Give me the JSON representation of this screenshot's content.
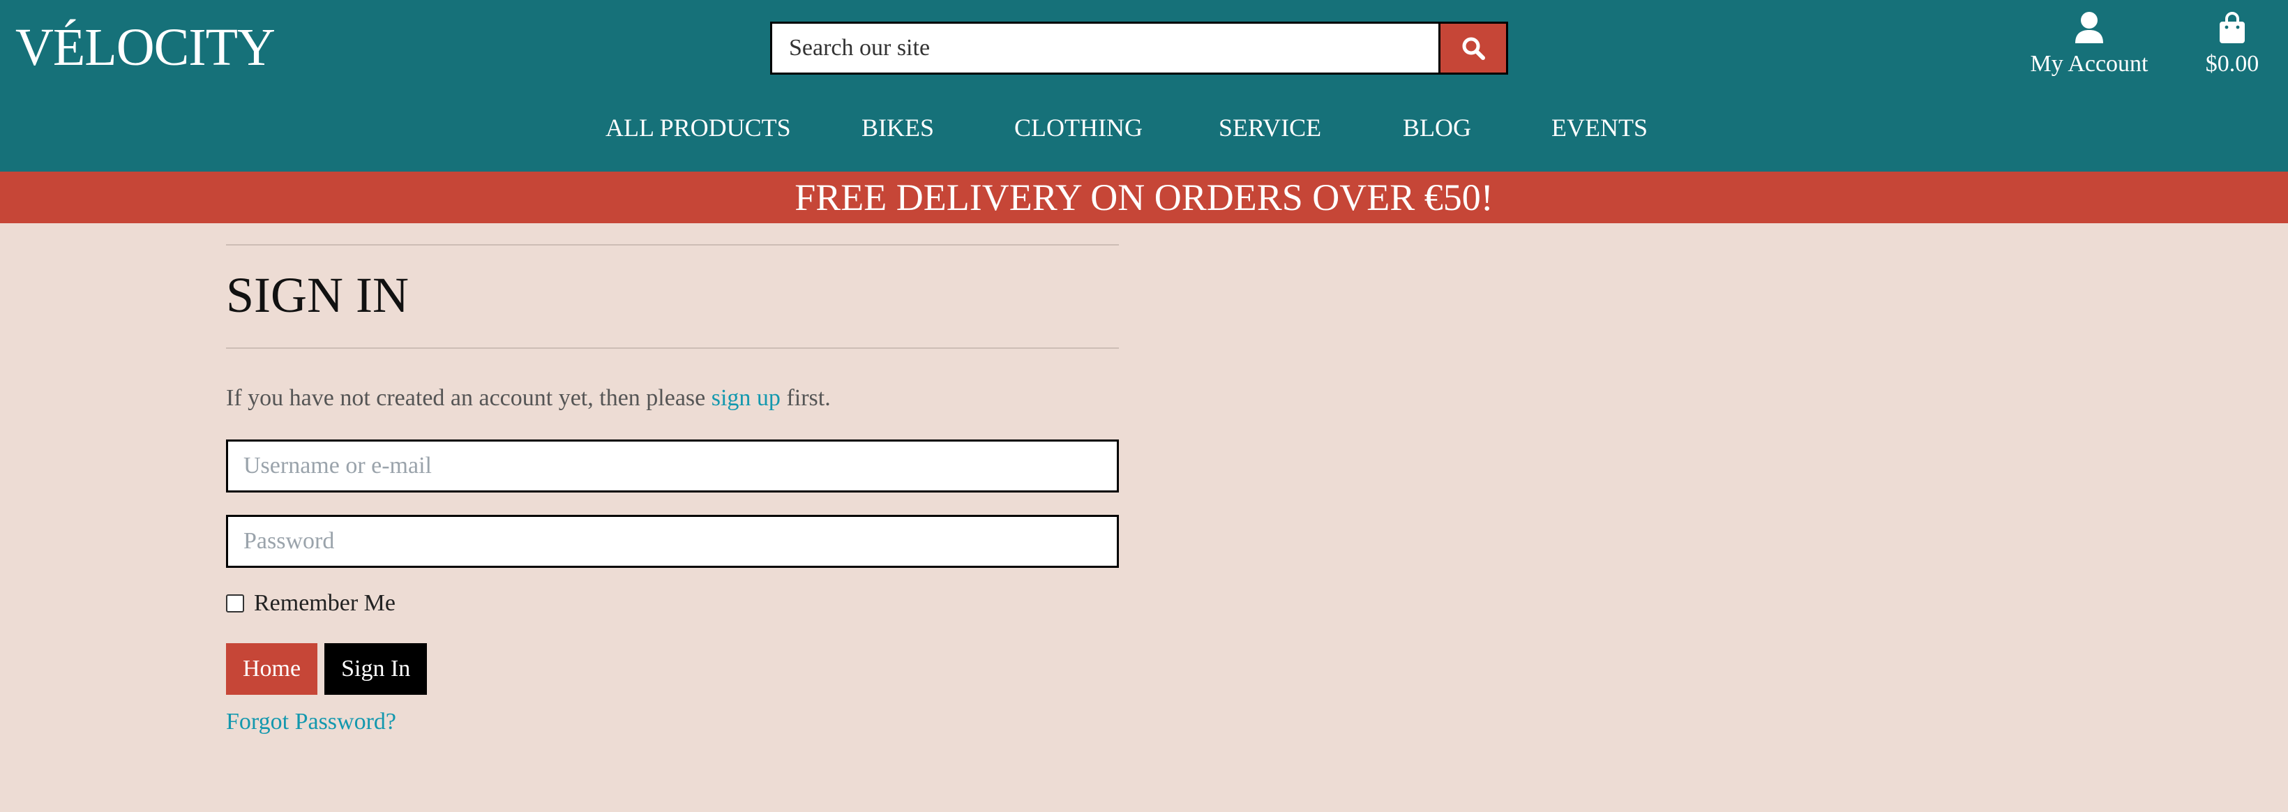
{
  "header": {
    "logo": "VÉLOCITY",
    "search": {
      "placeholder": "Search our site"
    },
    "account_label": "My Account",
    "cart_total": "$0.00",
    "colors": {
      "header_bg": "#167179",
      "accent": "#C64637",
      "link": "#1398AE",
      "page_bg": "#EDDCD4"
    }
  },
  "nav": {
    "items": [
      {
        "label": "ALL PRODUCTS"
      },
      {
        "label": "BIKES"
      },
      {
        "label": "CLOTHING"
      },
      {
        "label": "SERVICE"
      },
      {
        "label": "BLOG"
      },
      {
        "label": "EVENTS"
      }
    ]
  },
  "banner": {
    "text": "FREE DELIVERY ON ORDERS OVER €50!"
  },
  "signin": {
    "title": "SIGN IN",
    "intro_before": "If you have not created an account yet, then please ",
    "intro_link": "sign up",
    "intro_after": " first.",
    "username_placeholder": "Username or e-mail",
    "password_placeholder": "Password",
    "remember_label": "Remember Me",
    "home_button": "Home",
    "signin_button": "Sign In",
    "forgot_link": "Forgot Password?"
  },
  "icons": {
    "search": "search-icon",
    "account": "user-icon",
    "cart": "shopping-bag-icon"
  }
}
